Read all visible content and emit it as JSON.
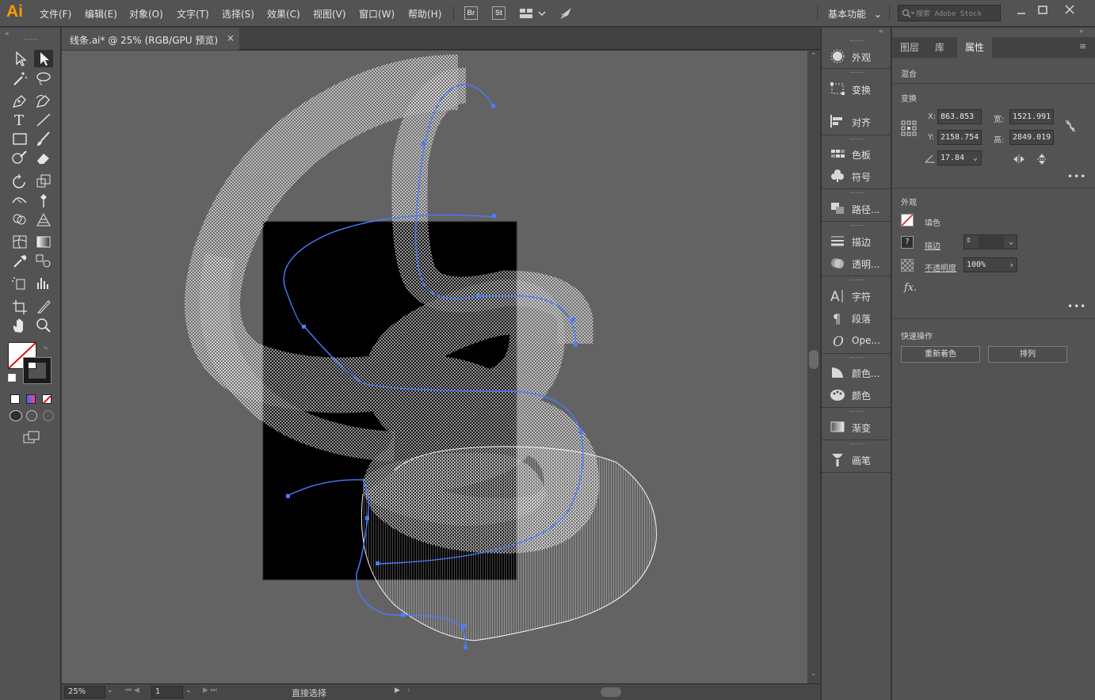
{
  "app": {
    "logo": "Ai"
  },
  "menubar": {
    "items": [
      "文件(F)",
      "编辑(E)",
      "对象(O)",
      "文字(T)",
      "选择(S)",
      "效果(C)",
      "视图(V)",
      "窗口(W)",
      "帮助(H)"
    ],
    "bridge_label": "Br",
    "stock_label": "St",
    "workspace": "基本功能",
    "search_placeholder": "搜索 Adobe Stock"
  },
  "document": {
    "tab_title": "线条.ai* @ 25% (RGB/GPU 预览)",
    "close": "×"
  },
  "statusbar": {
    "zoom": "25%",
    "artboard": "1",
    "tool": "直接选择"
  },
  "icon_panel": {
    "items": [
      "外观",
      "变换",
      "对齐",
      "色板",
      "符号",
      "路径...",
      "描边",
      "透明...",
      "字符",
      "段落",
      "Ope...",
      "颜色...",
      "颜色",
      "渐变",
      "画笔"
    ]
  },
  "properties": {
    "tabs": [
      "图层",
      "库",
      "属性"
    ],
    "active_tab": "属性",
    "blend_title": "混合",
    "transform": {
      "title": "变换",
      "x_label": "X:",
      "x": "863.853",
      "y_label": "Y:",
      "y": "2158.754",
      "w_label": "宽:",
      "w": "1521.991",
      "h_label": "高:",
      "h": "2849.019",
      "angle": "17.84"
    },
    "appearance": {
      "title": "外观",
      "fill_label": "填色",
      "stroke_label": "描边",
      "opacity_label": "不透明度",
      "opacity": "100%",
      "fx": "fx."
    },
    "quick_actions": {
      "title": "快速操作",
      "recolor": "重新着色",
      "arrange": "排列"
    }
  },
  "colors": {
    "accent": "#4a7cff",
    "menu_bg": "#535353",
    "canvas_bg": "#636363",
    "artboard": "#000000",
    "logo": "#ff9a00"
  }
}
